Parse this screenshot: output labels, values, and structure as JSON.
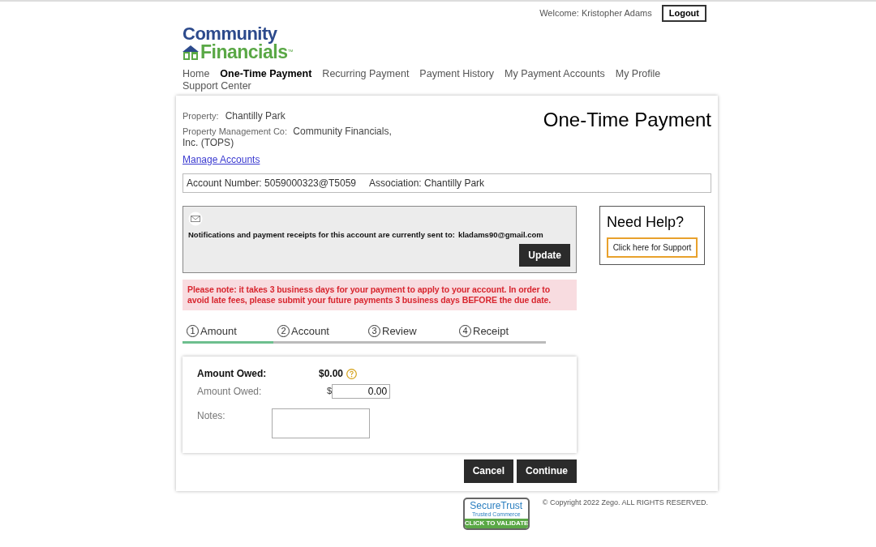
{
  "header": {
    "welcome": "Welcome: Kristopher Adams",
    "logout": "Logout"
  },
  "logo": {
    "line1": "Community",
    "line2": "Financials",
    "trademark": "™"
  },
  "nav": [
    {
      "label": "Home",
      "selected": false
    },
    {
      "label": "One-Time Payment",
      "selected": true
    },
    {
      "label": "Recurring Payment",
      "selected": false
    },
    {
      "label": "Payment History",
      "selected": false
    },
    {
      "label": "My Payment Accounts",
      "selected": false
    },
    {
      "label": "My Profile",
      "selected": false
    },
    {
      "label": "Support Center",
      "selected": false
    }
  ],
  "property": {
    "label": "Property:",
    "value": "Chantilly Park"
  },
  "management": {
    "label": "Property Management Co:",
    "value": "Community Financials, Inc. (TOPS)"
  },
  "manage_link": "Manage Accounts",
  "page_title": "One-Time Payment",
  "account_bar": {
    "account": "Account Number: 5059000323@T5059",
    "association": "Association: Chantilly Park"
  },
  "notification": {
    "text": "Notifications and payment receipts for this account are currently sent to:",
    "email": "kladams90@gmail.com",
    "button": "Update"
  },
  "help": {
    "title": "Need Help?",
    "button": "Click here for Support"
  },
  "alert": "Please note: it takes 3 business days for your payment to apply to your account. In order to avoid late fees, please submit your future payments 3 business days BEFORE the due date.",
  "steps": [
    {
      "number": "1",
      "label": "Amount",
      "selected": true
    },
    {
      "number": "2",
      "label": "Account",
      "selected": false
    },
    {
      "number": "3",
      "label": "Review",
      "selected": false
    },
    {
      "number": "4",
      "label": "Receipt",
      "selected": false
    }
  ],
  "form": {
    "owed_label": "Amount Owed:",
    "owed_value": "$0.00",
    "amount_label": "Amount Owed:",
    "currency": "$",
    "amount_value": "0.00",
    "notes_label": "Notes:"
  },
  "buttons": [
    "Cancel",
    "Continue"
  ],
  "footer": {
    "seal": {
      "line1": "SecureTrust",
      "line2": "Trusted Commerce",
      "line3": "CLICK TO VALIDATE"
    },
    "copyright": "© Copyright 2022 Zego. ALL RIGHTS RESERVED."
  }
}
